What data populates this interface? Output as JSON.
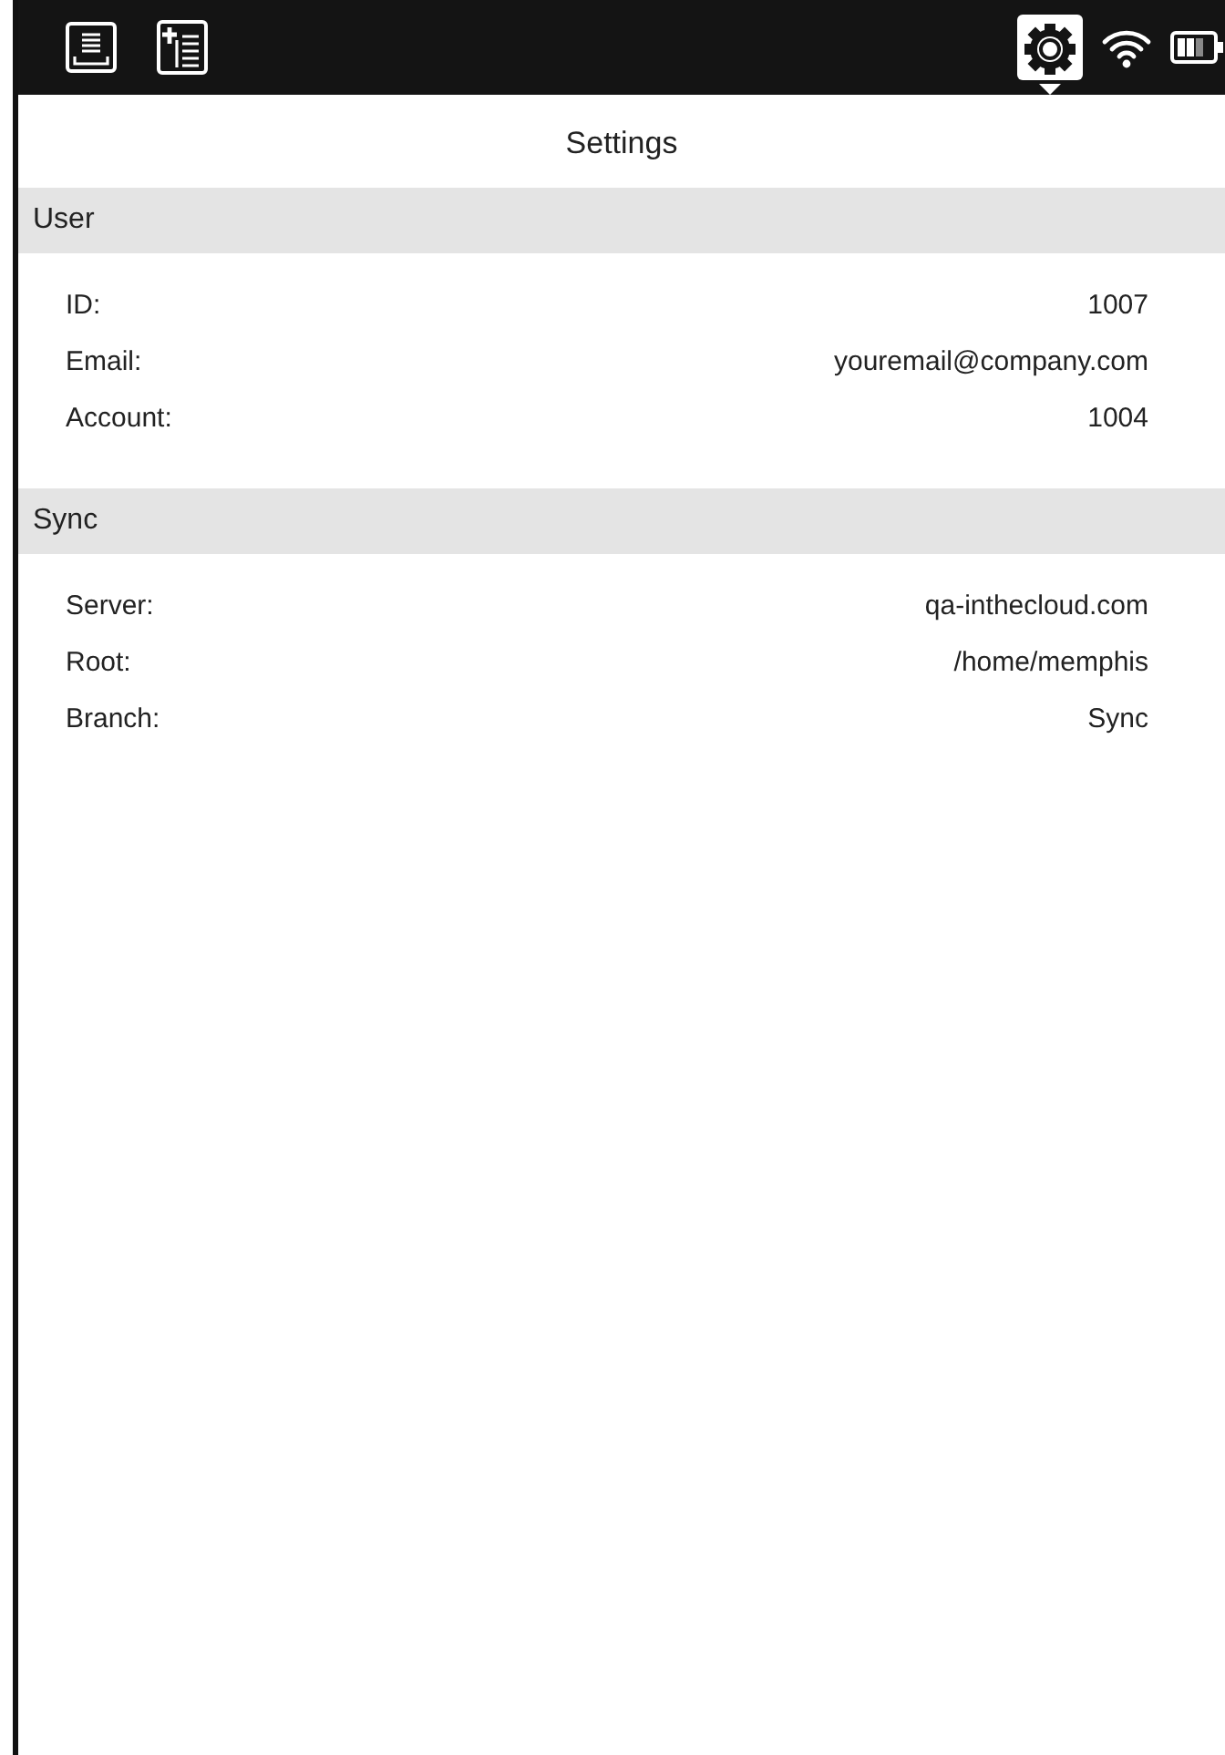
{
  "toolbar": {
    "left_tools": [
      {
        "kind": "tray",
        "selected": false
      },
      {
        "kind": "add-list",
        "selected": false
      }
    ],
    "right_tools": [
      {
        "kind": "settings",
        "selected": true
      }
    ]
  },
  "title": "Settings",
  "sections": [
    {
      "header": "User",
      "rows": [
        {
          "label": "ID:",
          "value": "1007"
        },
        {
          "label": "Email:",
          "value": "youremail@company.com"
        },
        {
          "label": "Account:",
          "value": "1004"
        }
      ]
    },
    {
      "header": "Sync",
      "rows": [
        {
          "label": "Server:",
          "value": "qa-inthecloud.com"
        },
        {
          "label": "Root:",
          "value": "/home/memphis"
        },
        {
          "label": "Branch:",
          "value": "Sync"
        }
      ]
    }
  ]
}
